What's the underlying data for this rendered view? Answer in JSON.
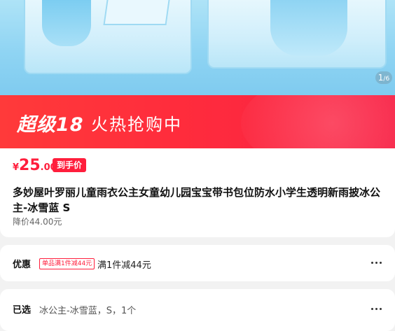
{
  "gallery": {
    "counter_current": "1",
    "counter_total": "6",
    "counter_sep": "/",
    "colors": {
      "background": "#8fd4f3",
      "coat": "#cfeefb"
    }
  },
  "banner": {
    "title": "超级18",
    "subtitle": "火热抢购中",
    "color": "#ff2c3c"
  },
  "product": {
    "currency": "¥",
    "price_integer": "25",
    "price_decimal": ".00",
    "price_badge": "到手价",
    "title": "多妙屋叶罗丽儿童雨衣公主女童幼儿园宝宝带书包位防水小学生透明新雨披冰公主-冰雪蓝 S",
    "original_price": "降价44.00元",
    "accent_color": "#ff1e3c"
  },
  "coupon": {
    "label": "优惠",
    "tag": "单品满1件减44元",
    "text": "满1件减44元",
    "more_icon": "more-dots-icon"
  },
  "selected": {
    "label": "已选",
    "text": "冰公主-冰雪蓝，S，1个",
    "more_icon": "more-dots-icon"
  }
}
